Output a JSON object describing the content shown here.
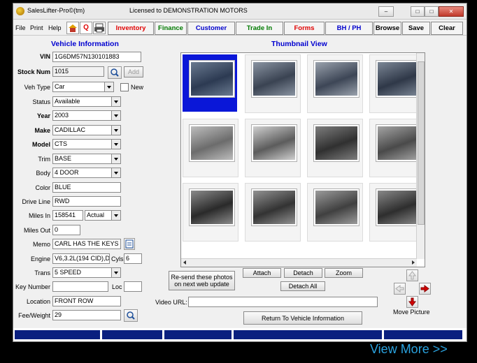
{
  "window": {
    "app_title": "SalesLifter-Pro©(tm)",
    "license": "Licensed to DEMONSTRATION MOTORS",
    "minimize": "‒",
    "maximize": "□",
    "close": "✕"
  },
  "menu": {
    "file": "File",
    "print": "Print",
    "help": "Help",
    "q_label": "Q"
  },
  "tabs": [
    {
      "label": "Inventory",
      "color": "#e00000"
    },
    {
      "label": "Finance",
      "color": "#007a00"
    },
    {
      "label": "Customer",
      "color": "#0000cc"
    },
    {
      "label": "Trade In",
      "color": "#007a00"
    },
    {
      "label": "Forms",
      "color": "#e00000"
    },
    {
      "label": "BH / PH",
      "color": "#0000cc"
    }
  ],
  "toolbar": {
    "browse": "Browse",
    "save": "Save",
    "clear": "Clear"
  },
  "vehicle": {
    "section_title": "Vehicle Information",
    "vin_label": "VIN",
    "vin": "1G6DM57N130101883",
    "stock_label": "Stock Num",
    "stock": "1015",
    "add_button": "Add",
    "vehtype_label": "Veh Type",
    "vehtype": "Car",
    "new_label": "New",
    "status_label": "Status",
    "status": "Available",
    "year_label": "Year",
    "year": "2003",
    "make_label": "Make",
    "make": "CADILLAC",
    "model_label": "Model",
    "model": "CTS",
    "trim_label": "Trim",
    "trim": "BASE",
    "body_label": "Body",
    "body": "4 DOOR",
    "color_label": "Color",
    "color": "BLUE",
    "driveline_label": "Drive Line",
    "driveline": "RWD",
    "milesin_label": "Miles In",
    "milesin": "158541",
    "miles_type": "Actual",
    "milesout_label": "Miles Out",
    "milesout": "0",
    "memo_label": "Memo",
    "memo": "CARL HAS THE KEYS",
    "engine_label": "Engine",
    "engine": "V6,3.2L(194 CID),D",
    "cyls_label": "Cyls",
    "cyls": "6",
    "trans_label": "Trans",
    "trans": "5 SPEED",
    "keynumber_label": "Key Number",
    "keynumber": "",
    "loc_label": "Loc",
    "loc": "",
    "location_label": "Location",
    "location": "FRONT ROW",
    "feeweight_label": "Fee/Weight",
    "feeweight": "29"
  },
  "thumbnails": {
    "section_title": "Thumbnail View",
    "photos": [
      {
        "name": "exterior-front",
        "selected": true
      },
      {
        "name": "exterior-rear"
      },
      {
        "name": "exterior-rear-center"
      },
      {
        "name": "exterior-rear-quarter"
      },
      {
        "name": "interior-rear-seat"
      },
      {
        "name": "interior-front-seats"
      },
      {
        "name": "instrument-cluster"
      },
      {
        "name": "dashboard-console"
      },
      {
        "name": "engine-bay"
      },
      {
        "name": "gauges"
      },
      {
        "name": "center-console"
      },
      {
        "name": "engine-detail"
      }
    ],
    "resend_button": "Re-send these photos on next web update",
    "attach_button": "Attach",
    "detach_button": "Detach",
    "zoom_button": "Zoom",
    "detach_all_button": "Detach All",
    "video_url_label": "Video URL:",
    "video_url": "",
    "move_picture_label": "Move Picture",
    "return_button": "Return To Vehicle Information"
  },
  "footer": {
    "view_more": "View More >>"
  }
}
